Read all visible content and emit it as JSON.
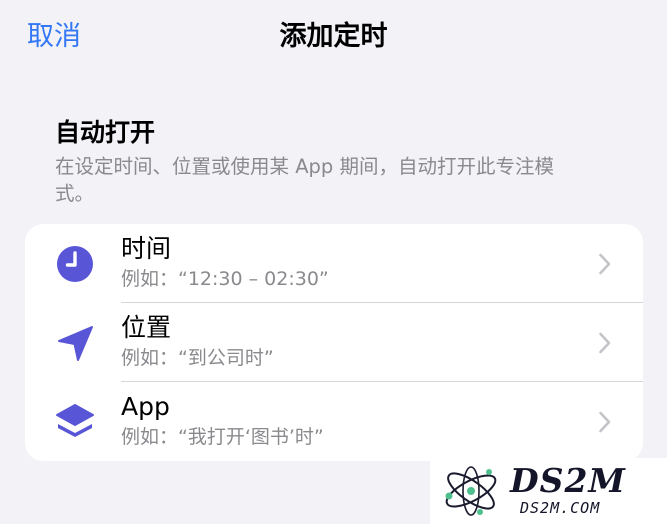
{
  "nav": {
    "cancel_label": "取消",
    "title": "添加定时"
  },
  "section": {
    "title": "自动打开",
    "description": "在设定时间、位置或使用某 App 期间，自动打开此专注模式。"
  },
  "rows": [
    {
      "label": "时间",
      "subtitle": "例如：“12:30 – 02:30”",
      "icon": "clock-icon"
    },
    {
      "label": "位置",
      "subtitle": "例如：“到公司时”",
      "icon": "location-arrow-icon"
    },
    {
      "label": "App",
      "subtitle": "例如：“我打开‘图书’时”",
      "icon": "app-stack-icon"
    }
  ],
  "watermark": {
    "name": "DS2M",
    "domain": "DS2M.COM"
  },
  "colors": {
    "accent": "#3478f6",
    "icon_purple": "#5856d6",
    "background": "#f2f2f7",
    "secondary_text": "#8a8a8e"
  }
}
